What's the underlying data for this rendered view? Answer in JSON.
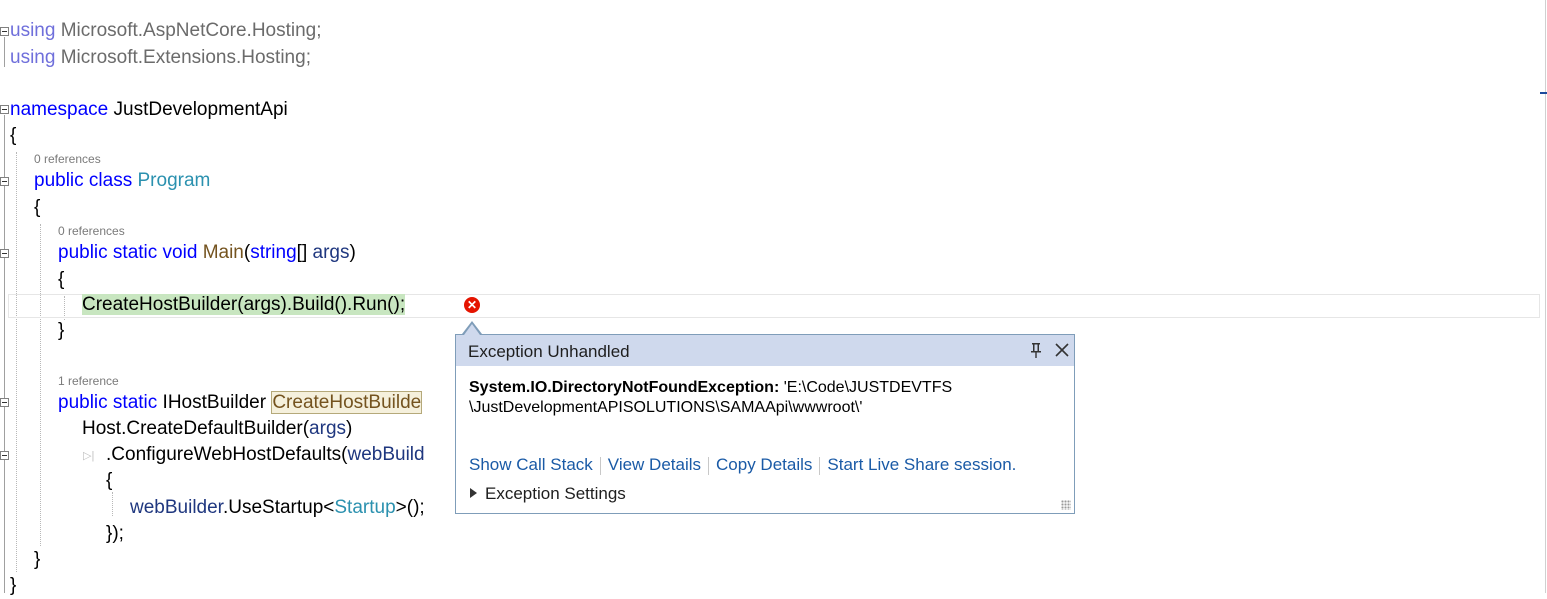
{
  "code": {
    "l1": {
      "kw": "using",
      "rest": " Microsoft.AspNetCore.Hosting;"
    },
    "l2": {
      "kw": "using",
      "rest": " Microsoft.Extensions.Hosting;"
    },
    "l3": {
      "kw": "namespace",
      "rest": " JustDevelopmentApi"
    },
    "l4": "{",
    "l5_lens": "0 references",
    "l5": {
      "kw": "public class",
      "type": "Program"
    },
    "l6": "{",
    "l7_lens": "0 references",
    "l7": {
      "kw": "public static void",
      "method": "Main",
      "open": "(",
      "kw2": "string",
      "brk": "[] ",
      "param": "args",
      "close": ")"
    },
    "l8": "{",
    "l9": "CreateHostBuilder(args).Build().Run();",
    "l10": "}",
    "l11_lens": "1 reference",
    "l11": {
      "kw": "public static",
      "type": " IHostBuilder ",
      "method": "CreateHostBuilde"
    },
    "l12": {
      "pre": "Host.CreateDefaultBuilder(",
      "param": "args",
      "post": ")"
    },
    "l13": {
      "pre": ".ConfigureWebHostDefaults(",
      "param": "webBuild"
    },
    "l14": "{",
    "l15": {
      "param": "webBuilder",
      "mid": ".UseStartup<",
      "type": "Startup",
      "post": ">();"
    },
    "l16": "});",
    "l17": "}",
    "l18": "}"
  },
  "popup": {
    "title": "Exception Unhandled",
    "exception_type": "System.IO.DirectoryNotFoundException:",
    "exception_message": " 'E:\\Code\\JUSTDEVTFS \\JustDevelopmentAPISOLUTIONS\\SAMAApi\\wwwroot\\'",
    "links": [
      "Show Call Stack",
      "View Details",
      "Copy Details",
      "Start Live Share session."
    ],
    "settings_label": "Exception Settings",
    "pin_icon": "pin-icon",
    "close_icon": "close-icon"
  },
  "error_icon": "error-icon",
  "colors": {
    "keyword": "#0000ff",
    "type": "#2b91af",
    "method": "#74531f",
    "param": "#1f377f",
    "error": "#e51400",
    "popup_header": "#cfd9ed",
    "link": "#1a5aa6",
    "current_statement": "#c8e6c0"
  }
}
